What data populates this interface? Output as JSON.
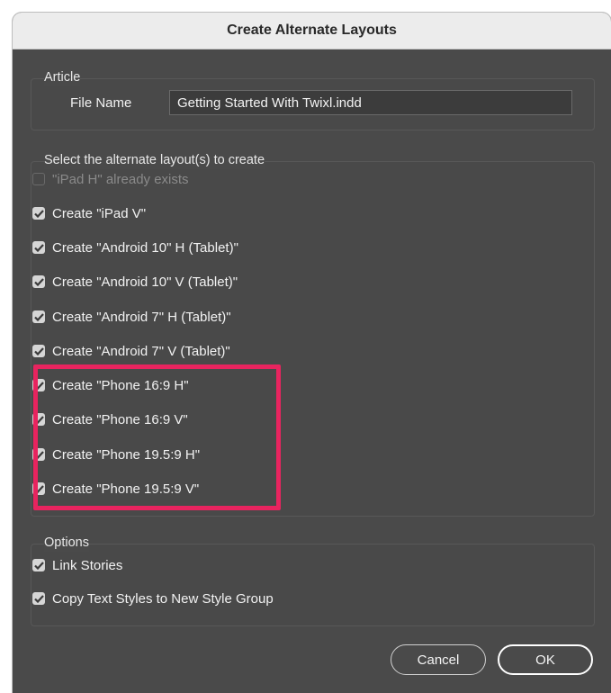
{
  "dialog": {
    "title": "Create Alternate Layouts"
  },
  "article": {
    "legend": "Article",
    "file_name_label": "File Name",
    "file_name_value": "Getting Started With Twixl.indd"
  },
  "layouts": {
    "legend": "Select the alternate layout(s) to create",
    "items": [
      {
        "label": "\"iPad H\" already exists",
        "checked": false,
        "disabled": true
      },
      {
        "label": "Create \"iPad V\"",
        "checked": true,
        "disabled": false
      },
      {
        "label": "Create \"Android 10\" H (Tablet)\"",
        "checked": true,
        "disabled": false
      },
      {
        "label": "Create \"Android 10\" V (Tablet)\"",
        "checked": true,
        "disabled": false
      },
      {
        "label": "Create \"Android 7\" H (Tablet)\"",
        "checked": true,
        "disabled": false
      },
      {
        "label": "Create \"Android 7\" V (Tablet)\"",
        "checked": true,
        "disabled": false
      },
      {
        "label": "Create \"Phone 16:9 H\"",
        "checked": true,
        "disabled": false
      },
      {
        "label": "Create \"Phone 16:9 V\"",
        "checked": true,
        "disabled": false
      },
      {
        "label": "Create \"Phone 19.5:9 H\"",
        "checked": true,
        "disabled": false
      },
      {
        "label": "Create \"Phone 19.5:9 V\"",
        "checked": true,
        "disabled": false
      }
    ]
  },
  "options": {
    "legend": "Options",
    "items": [
      {
        "label": "Link Stories",
        "checked": true
      },
      {
        "label": "Copy Text Styles to New Style Group",
        "checked": true
      }
    ]
  },
  "buttons": {
    "cancel": "Cancel",
    "ok": "OK"
  },
  "colors": {
    "highlight": "#e8245f",
    "dialog_bg": "#4a4a4a"
  }
}
